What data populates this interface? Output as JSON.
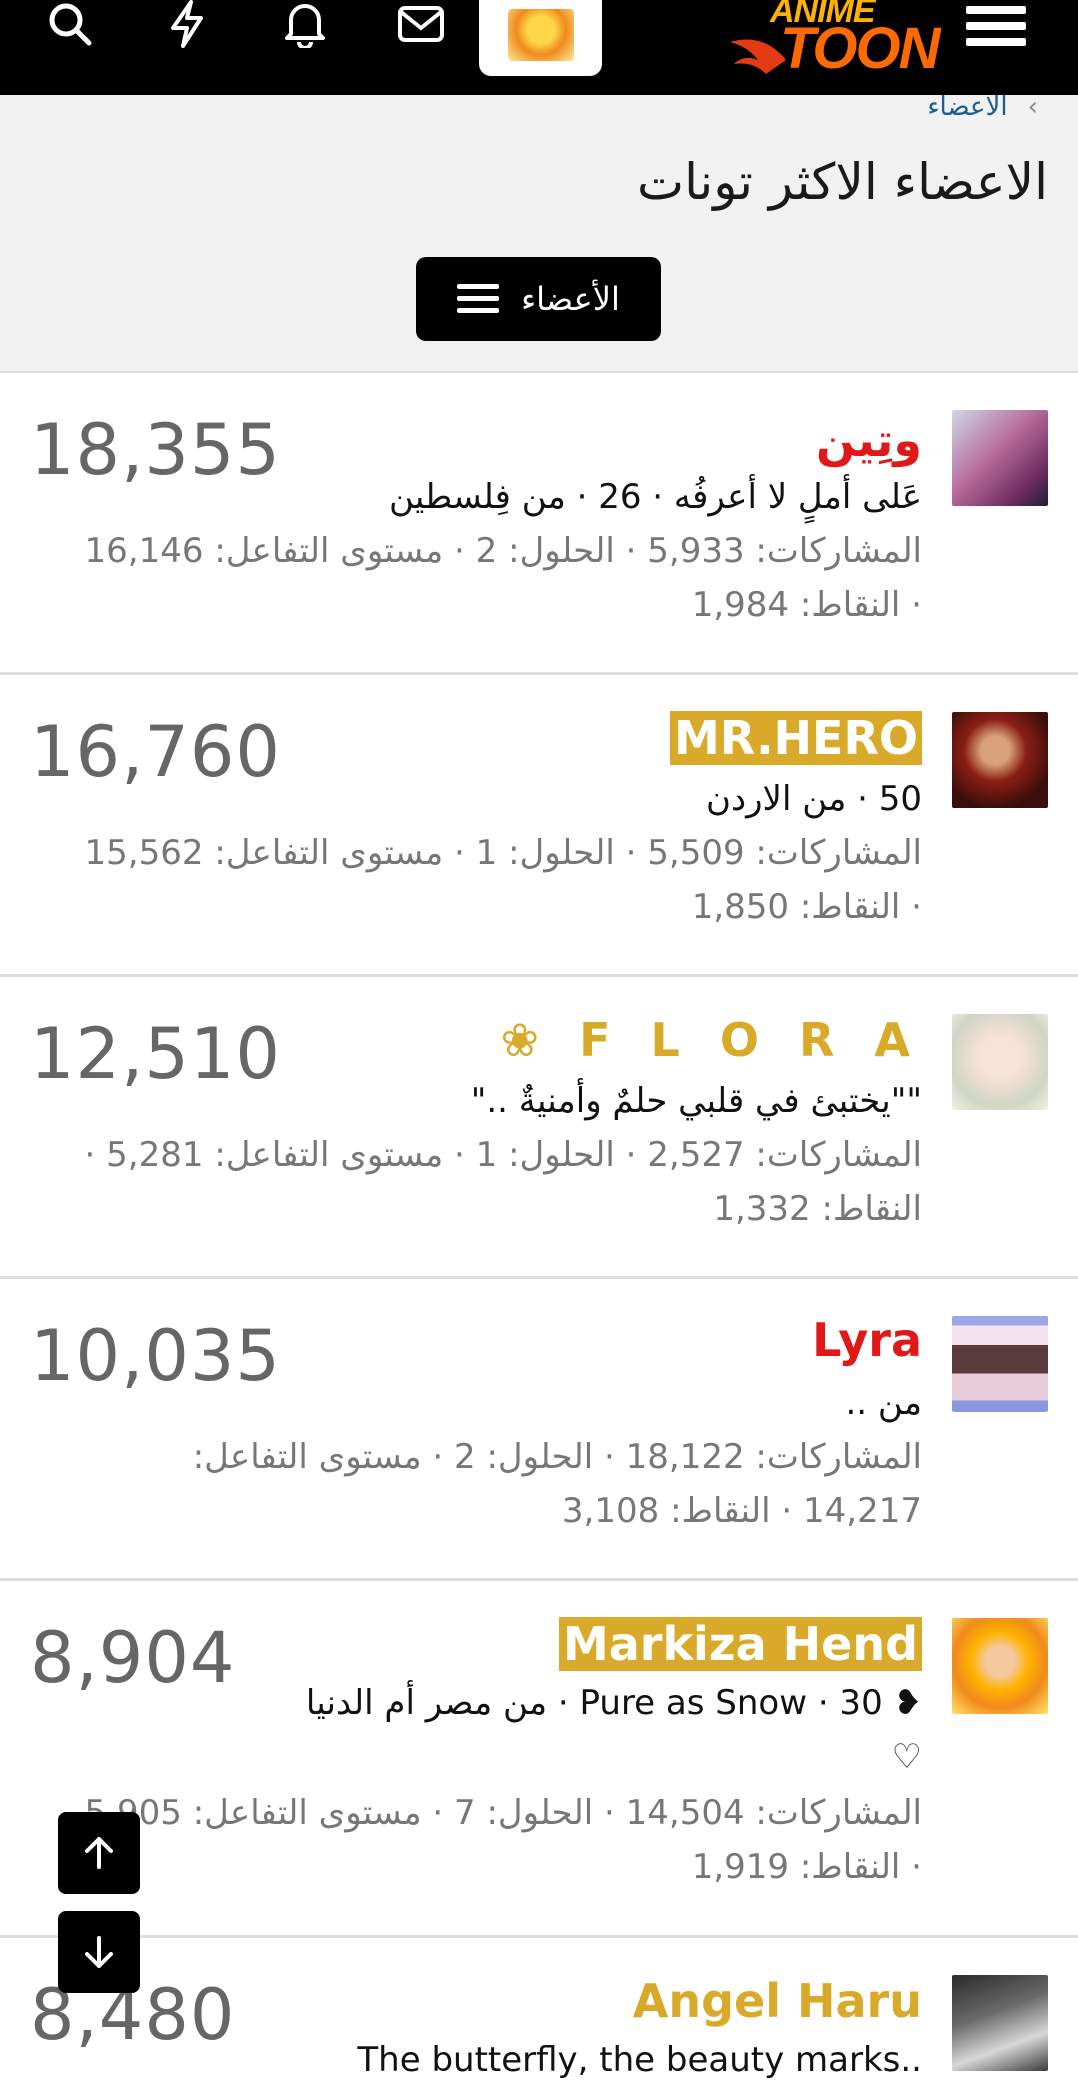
{
  "nav": {
    "icons": [
      "search-icon",
      "bolt-icon",
      "bell-icon",
      "mail-icon",
      "user-avatar",
      "menu-icon"
    ],
    "logo_top": "ANIME",
    "logo_main": "TOON"
  },
  "breadcrumb": {
    "item": "الاعضاء",
    "chevron": "›"
  },
  "page_title": "الاعضاء الاكثر تونات",
  "members_button": "الأعضاء",
  "entries": [
    {
      "name": "وتِين",
      "count": "18,355",
      "line": "عَلى أملٍ لا أعرفُه · 26 · من فِلسطين",
      "stats1": "المشاركات: 5,933 · الحلول: 2 · مستوى التفاعل: 16,146",
      "stats2": "· النقاط: 1,984"
    },
    {
      "name": "MR.HERO",
      "count": "16,760",
      "line": "50 · من الاردن",
      "stats1": "المشاركات: 5,509 · الحلول: 1 · مستوى التفاعل: 15,562",
      "stats2": "· النقاط: 1,850"
    },
    {
      "name": "F L O R A ❀",
      "count": "12,510",
      "line": "\"\"يختبئ في قلبي حلمٌ وأمنيةٌ ..\"",
      "stats1": "المشاركات: 2,527 · الحلول: 1 · مستوى التفاعل: 5,281 ·",
      "stats2": "النقاط: 1,332"
    },
    {
      "name": "Lyra",
      "count": "10,035",
      "line": "من ..",
      "stats1": "المشاركات: 18,122 · الحلول: 2 · مستوى التفاعل:",
      "stats2": "14,217 · النقاط: 3,108"
    },
    {
      "name": "Markiza Hend",
      "count": "8,904",
      "line": "❥ Pure as Snow · 30 · من مصر أم الدنيا",
      "line2": "♡",
      "stats1": "المشاركات: 14,504 · الحلول: 7 · مستوى التفاعل: 5,905",
      "stats2": "· النقاط: 1,919"
    },
    {
      "name": "Angel Haru",
      "count": "8,480",
      "line": "The butterfly, the beauty marks.."
    }
  ],
  "scroll_buttons": {
    "up": "↑",
    "down": "↓"
  }
}
